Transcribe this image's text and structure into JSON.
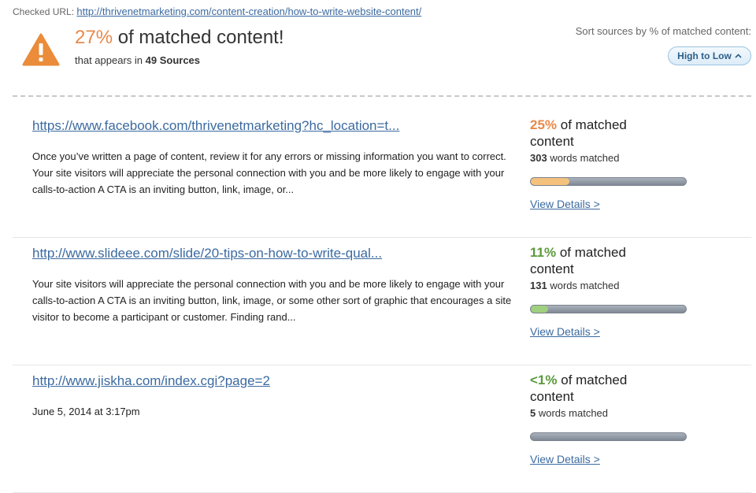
{
  "header": {
    "checked_url_label": "Checked URL:",
    "checked_url": "http://thrivenetmarketing.com/content-creation/how-to-write-website-content/",
    "percent": "27%",
    "headline_rest": "of matched content!",
    "sub_prefix": "that appears in",
    "sources_count": "49 Sources",
    "sort_label": "Sort sources by % of matched content:",
    "sort_button": "High to Low",
    "warning_color": "#ea8c3a"
  },
  "results": [
    {
      "url": "https://www.facebook.com/thrivenetmarketing?hc_location=t...",
      "excerpt": "Once you’ve written a page of content, review it for any errors or missing information you want to correct. Your site visitors will appreciate the personal connection with you and be more likely to engage with your calls-to-action A CTA is an inviting button, link, image, or...",
      "percent": "25%",
      "percent_suffix": "of matched content",
      "percent_color": "#e8894a",
      "words_count": "303",
      "words_suffix": "words matched",
      "bar_fraction": 0.25,
      "bar_color": "#f5c27e",
      "details": "View Details >"
    },
    {
      "url": "http://www.slideee.com/slide/20-tips-on-how-to-write-qual...",
      "excerpt": "Your site visitors will appreciate the personal connection with you and be more likely to engage with your calls-to-action A CTA is an inviting button, link, image, or some other sort of graphic that encourages a site visitor to become a participant or customer. Finding rand...",
      "percent": "11%",
      "percent_suffix": "of matched content",
      "percent_color": "#5b9a3c",
      "words_count": "131",
      "words_suffix": "words matched",
      "bar_fraction": 0.11,
      "bar_color": "#9fd07e",
      "details": "View Details >"
    },
    {
      "url": "http://www.jiskha.com/index.cgi?page=2",
      "excerpt": "June 5, 2014 at 3:17pm",
      "percent": "<1%",
      "percent_suffix": "of matched content",
      "percent_color": "#5b9a3c",
      "words_count": "5",
      "words_suffix": "words matched",
      "bar_fraction": 0.0,
      "bar_color": "#9fd07e",
      "details": "View Details >"
    }
  ]
}
